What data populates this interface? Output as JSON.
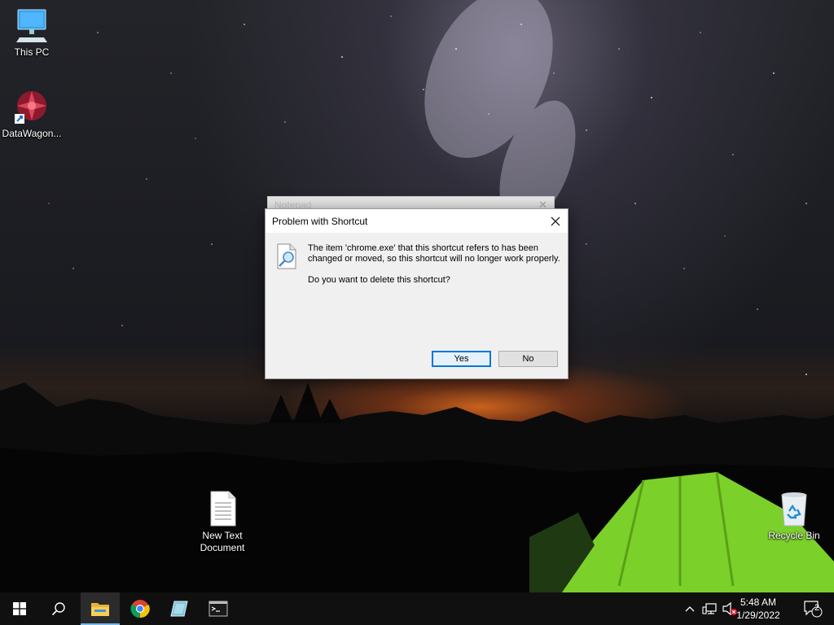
{
  "desktop": {
    "icons": [
      {
        "label": "This PC"
      },
      {
        "label": "DataWagon..."
      },
      {
        "label": "New Text Document"
      },
      {
        "label": "Recycle Bin"
      }
    ]
  },
  "background_dialog": {
    "title": "Notepad"
  },
  "dialog": {
    "title": "Problem with Shortcut",
    "message": "The item 'chrome.exe' that this shortcut refers to has been changed or moved, so this shortcut will no longer work properly.",
    "question": "Do you want to delete this shortcut?",
    "yes_label": "Yes",
    "no_label": "No"
  },
  "taskbar": {
    "apps": [
      {
        "icon": "start-icon"
      },
      {
        "icon": "search-icon"
      },
      {
        "icon": "file-explorer-icon",
        "active": true
      },
      {
        "icon": "chrome-icon"
      },
      {
        "icon": "app-icon"
      },
      {
        "icon": "terminal-icon"
      }
    ],
    "clock": {
      "time": "5:48 AM",
      "date": "1/29/2022"
    },
    "notifications_count": "2",
    "accent": "#76b9ed"
  }
}
